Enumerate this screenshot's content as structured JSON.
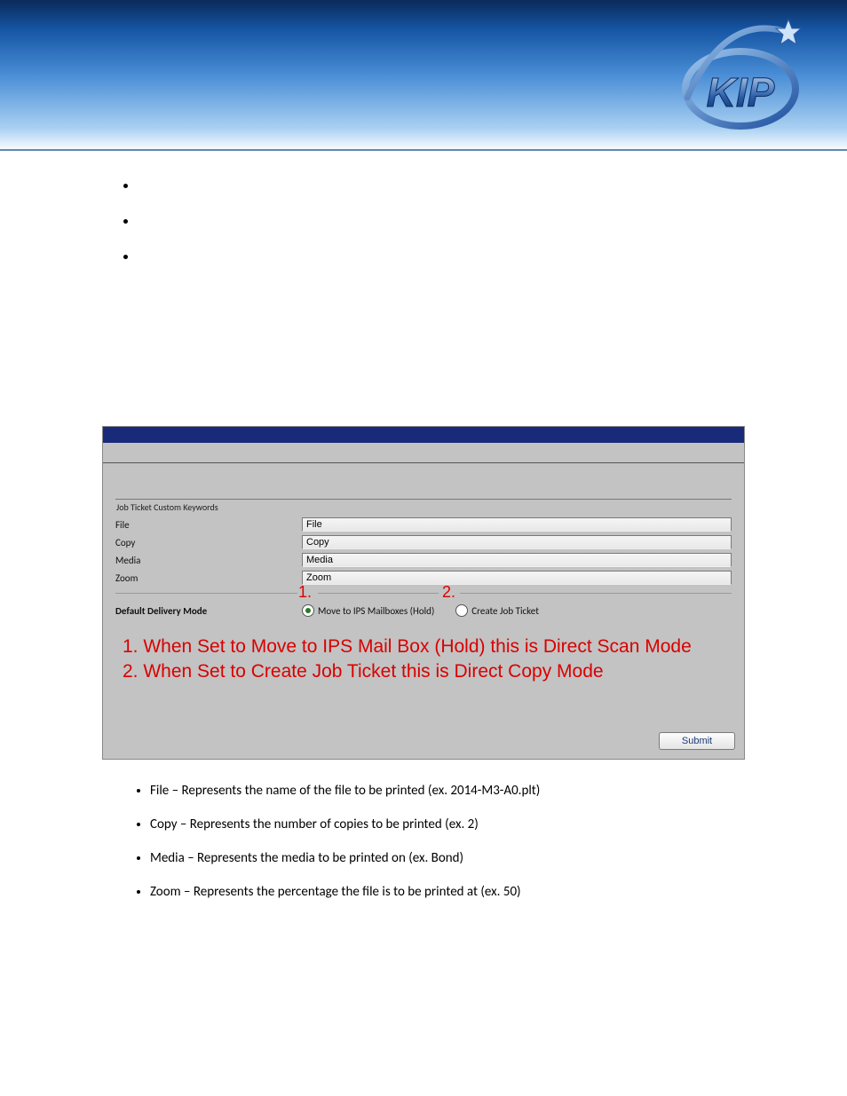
{
  "logo_text": "KIP",
  "top_bullets": [
    "",
    "",
    ""
  ],
  "panel": {
    "legend": "Job Ticket Custom Keywords",
    "fields": [
      {
        "label": "File",
        "value": "File"
      },
      {
        "label": "Copy",
        "value": "Copy"
      },
      {
        "label": "Media",
        "value": "Media"
      },
      {
        "label": "Zoom",
        "value": "Zoom"
      }
    ],
    "annot1": "1.",
    "annot2": "2.",
    "delivery_label": "Default Delivery Mode",
    "radio1": "Move to IPS Mailboxes (Hold)",
    "radio2": "Create Job Ticket",
    "radio_selected": 0,
    "red_line1": "1. When Set to Move to IPS Mail Box (Hold) this is Direct Scan Mode",
    "red_line2": "2. When Set to Create Job Ticket this is Direct Copy Mode",
    "submit": "Submit"
  },
  "definitions": [
    "File – Represents the name of the file to be printed (ex. 2014-M3-A0.plt)",
    "Copy – Represents the number of copies to be printed  (ex. 2)",
    "Media – Represents the media to be printed on (ex. Bond)",
    "Zoom – Represents the percentage the file is to be printed at (ex. 50)"
  ]
}
